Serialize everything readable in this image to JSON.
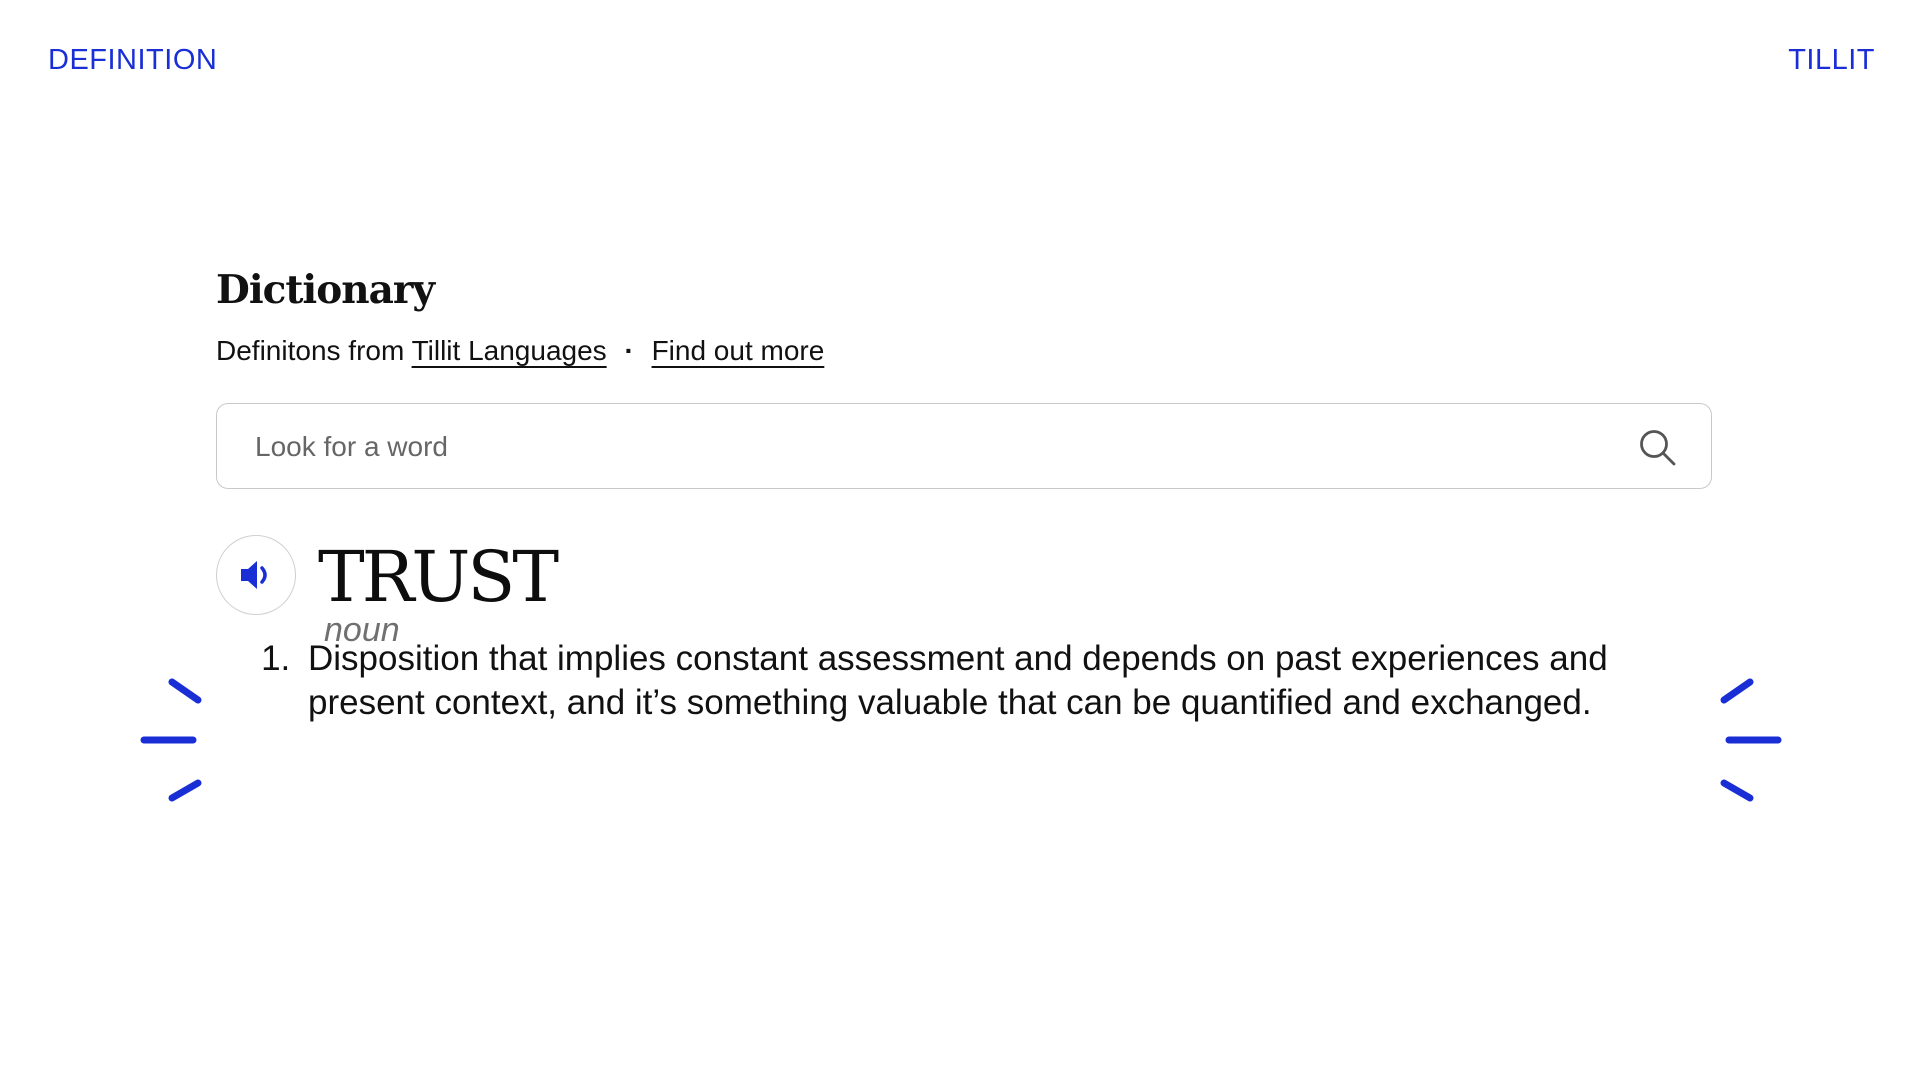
{
  "header": {
    "left_label": "DEFINITION",
    "right_label": "TILLIT"
  },
  "dictionary": {
    "title": "Dictionary",
    "source_prefix": "Definitons from",
    "source_link": "Tillit Languages",
    "separator": "·",
    "more_link": "Find out more"
  },
  "search": {
    "placeholder": "Look for a word",
    "icon": "search-icon"
  },
  "entry": {
    "word": "TRUST",
    "part_of_speech": "noun",
    "audio_icon": "speaker-icon",
    "definitions": [
      {
        "number": 1,
        "text": "Disposition that implies constant assessment and depends on past experiences and present context, and it’s something valuable that can be quantified and exchanged."
      }
    ]
  },
  "colors": {
    "accent": "#1a2ed6",
    "text": "#111111",
    "muted": "#707070",
    "border": "#c9c9c9"
  }
}
